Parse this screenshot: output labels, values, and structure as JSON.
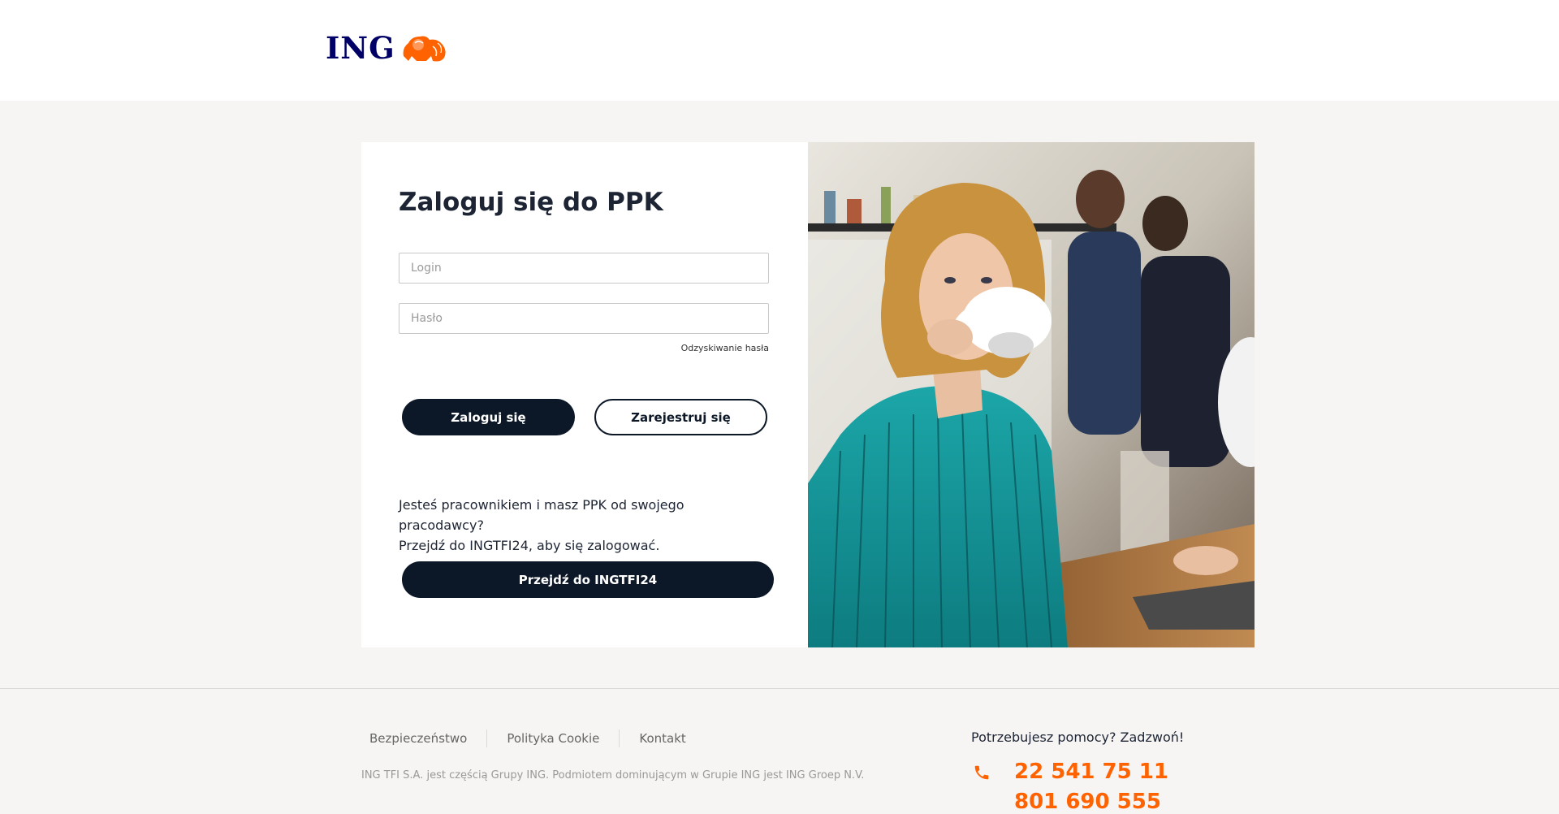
{
  "header": {
    "logo_text": "ING",
    "logo_icon": "lion-icon"
  },
  "login_form": {
    "title": "Zaloguj się do PPK",
    "login_placeholder": "Login",
    "password_placeholder": "Hasło",
    "recover_link": "Odzyskiwanie hasła",
    "login_button": "Zaloguj się",
    "register_button": "Zarejestruj się",
    "info_line1": "Jesteś pracownikiem i masz PPK od swojego pracodawcy?",
    "info_line2": "Przejdź do INGTFI24, aby się zalogować.",
    "ingtfi_button": "Przejdź do INGTFI24"
  },
  "footer": {
    "links": [
      "Bezpieczeństwo",
      "Polityka Cookie",
      "Kontakt"
    ],
    "legal": "ING TFI S.A. jest częścią Grupy ING. Podmiotem dominującym w Grupie ING jest ING Groep N.V.",
    "help_title": "Potrzebujesz pomocy? Zadzwoń!",
    "phone_icon": "phone-icon",
    "phone1": "22 541 75 11",
    "phone2": "801 690 555"
  },
  "colors": {
    "brand_orange": "#ff6200",
    "brand_navy": "#000066",
    "button_dark": "#0c1727",
    "page_bg": "#f6f5f3"
  }
}
